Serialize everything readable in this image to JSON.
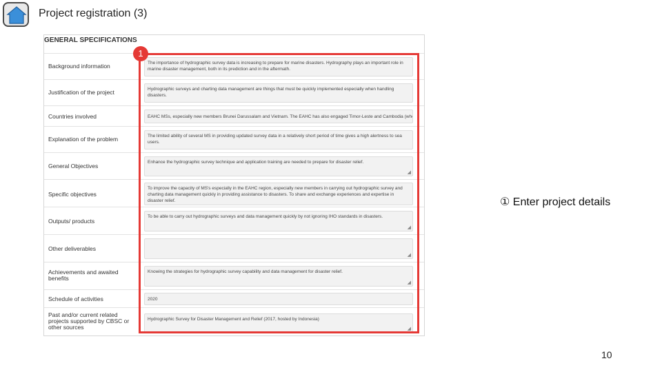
{
  "header": {
    "title": "Project registration (3)",
    "home_icon": "home-icon"
  },
  "form": {
    "section_title": "GENERAL SPECIFICATIONS",
    "rows": [
      {
        "label": "Background information",
        "value": "The importance of hydrographic survey data is increasing to prepare for marine disasters. Hydrography plays an important role in marine disaster management, both in its prediction and in the aftermath."
      },
      {
        "label": "Justification of the project",
        "value": "Hydrographic surveys and charting data management are things that must be quickly implemented especially when handling disasters."
      },
      {
        "label": "Countries involved",
        "value": "EAHC MSs, especially new members Brunei Darussalam and Vietnam. The EAHC has also engaged Timor-Leste and Cambodia (who"
      },
      {
        "label": "Explanation of the problem",
        "value": "The limited ability of several MS in providing updated survey data in a relatively short period of time gives a high alertness to sea users."
      },
      {
        "label": "General Objectives",
        "value": "Enhance the hydrographic survey technique and application training are needed to prepare for disaster relief."
      },
      {
        "label": "Specific objectives",
        "value": "To improve the capacity of MS's especially in the EAHC region, especially new members in carrying out hydrographic survey and charting data management quickly in providing assistance to disasters. To share and exchange experiences and expertise in disaster relief."
      },
      {
        "label": "Outputs/ products",
        "value": "To be able to carry out hydrographic surveys and data management quickly by not ignoring IHO standards in disasters."
      },
      {
        "label": "Other deliverables",
        "value": ""
      },
      {
        "label": "Achievements and awaited benefits",
        "value": "Knowing the strategies for hydrographic survey capability and data management for disaster relief."
      },
      {
        "label": "Schedule of activities",
        "value": "2020"
      },
      {
        "label": "Past and/or current related projects supported by CBSC or other sources",
        "value": "Hydrographic Survey for Disaster Management and Relief (2017, hosted by Indonesia)"
      }
    ]
  },
  "callout": {
    "badge": "1",
    "annotation": "① Enter project details",
    "accent_color": "#e53935"
  },
  "footer": {
    "page_number": "10"
  }
}
